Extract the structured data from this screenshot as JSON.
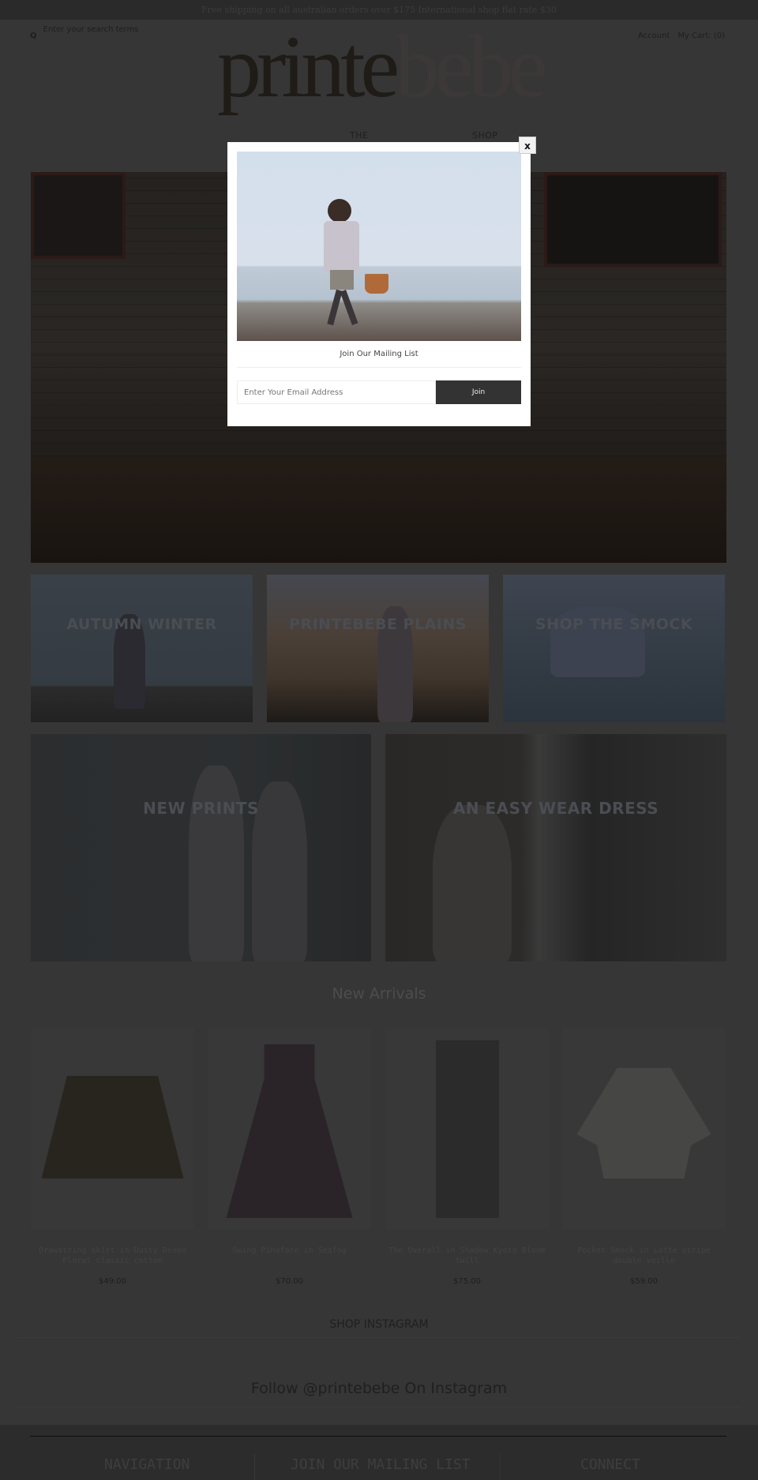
{
  "announcement": "Free shipping on all australian orders over $175 International shop flat rate $30",
  "header": {
    "search_placeholder": "Enter your search terms",
    "search_icon": "magnifier",
    "account": "Account",
    "cart": "My Cart: (0)",
    "logo_part1": "printe",
    "logo_part2": "bebe"
  },
  "nav": {
    "items": [
      "THE",
      "SHOP"
    ]
  },
  "tiles": [
    "AUTUMN WINTER",
    "PRINTEBEBE PLAINS",
    "SHOP THE SMOCK",
    "NEW PRINTS",
    "AN EASY WEAR DRESS"
  ],
  "new_arrivals": {
    "heading": "New Arrivals",
    "products": [
      {
        "title": "Drawstring skirt in Dusty Devon Floral classic cotton",
        "price": "$49.00"
      },
      {
        "title": "Swing Pinafore in Seafog",
        "price": "$70.00"
      },
      {
        "title": "The Overall in Shadow Kyoto Bloom twill",
        "price": "$75.00"
      },
      {
        "title": "Pocket Smock in Latte stripe double voille",
        "price": "$59.00"
      }
    ]
  },
  "instagram": {
    "heading": "SHOP INSTAGRAM",
    "follow": "Follow @printebebe On Instagram"
  },
  "footer": {
    "headings": [
      "NAVIGATION",
      "JOIN OUR MAILING LIST",
      "CONNECT"
    ]
  },
  "modal": {
    "title": "Join Our Mailing List",
    "email_placeholder": "Enter Your Email Address",
    "join": "Join",
    "close": "x"
  }
}
